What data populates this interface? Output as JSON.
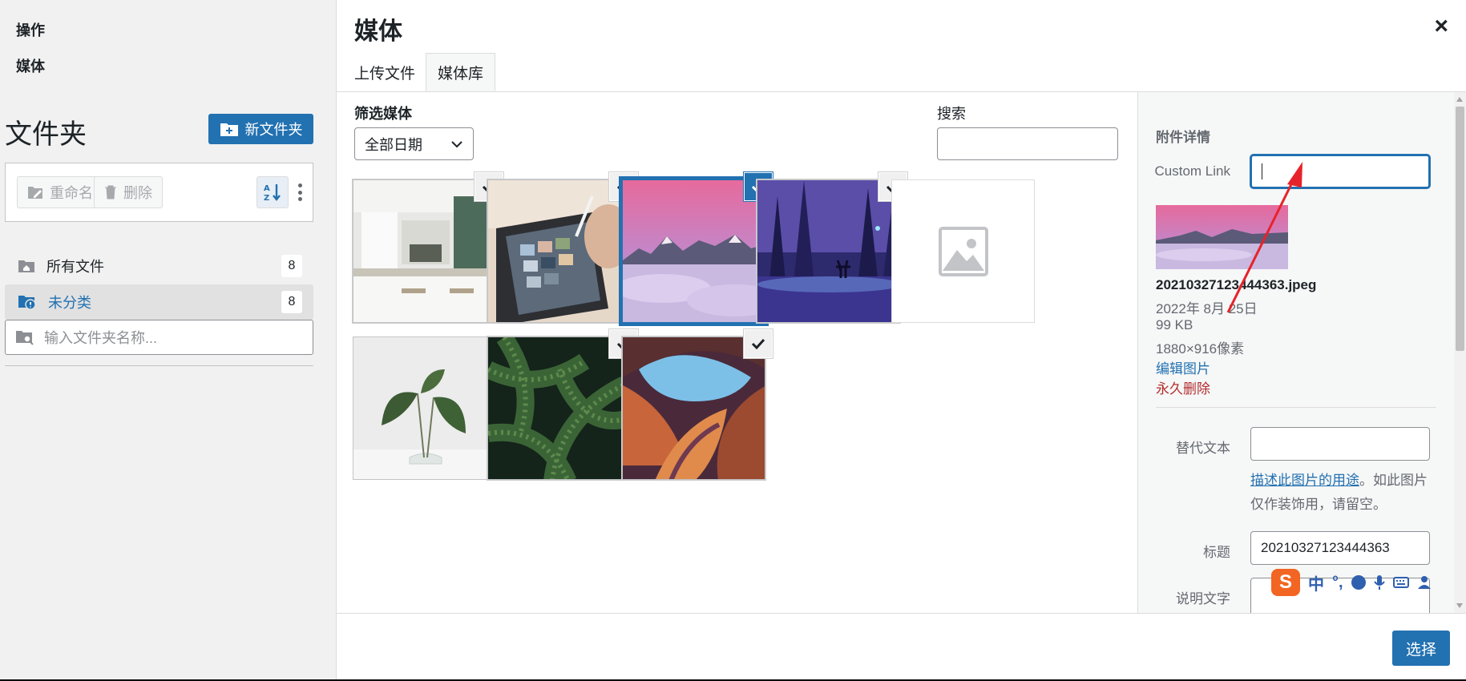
{
  "left_panel": {
    "menu_actions": "操作",
    "menu_media": "媒体",
    "folder_title": "文件夹",
    "new_folder_label": "新文件夹",
    "rename_label": "重命名",
    "delete_label": "删除",
    "folders": [
      {
        "label": "所有文件",
        "count": "8"
      },
      {
        "label": "未分类",
        "count": "8"
      }
    ],
    "folder_search_placeholder": "输入文件夹名称..."
  },
  "modal": {
    "title": "媒体",
    "close": "×",
    "tabs": [
      {
        "label": "上传文件"
      },
      {
        "label": "媒体库",
        "active": true
      }
    ],
    "filter_label": "筛选媒体",
    "filter_value": "全部日期",
    "search_label": "搜索",
    "search_value": "",
    "select_button": "选择"
  },
  "details": {
    "title": "附件详情",
    "custom_link_label": "Custom Link",
    "custom_link_value": "",
    "file_name": "20210327123444363.jpeg",
    "date": "2022年 8月 25日",
    "size": "99 KB",
    "dimensions": "1880×916像素",
    "edit_link": "编辑图片",
    "delete_link": "永久删除",
    "alt_label": "替代文本",
    "alt_value": "",
    "alt_help_link": "描述此图片的用途",
    "alt_help_text": "。如此图片仅作装饰用，请留空。",
    "title_label": "标题",
    "title_value": "20210327123444363",
    "caption_label": "说明文字"
  },
  "ime": {
    "logo": "S",
    "mode": "中",
    "punct": "°,"
  },
  "colors": {
    "accent": "#2271b1",
    "danger": "#b32d2e"
  }
}
